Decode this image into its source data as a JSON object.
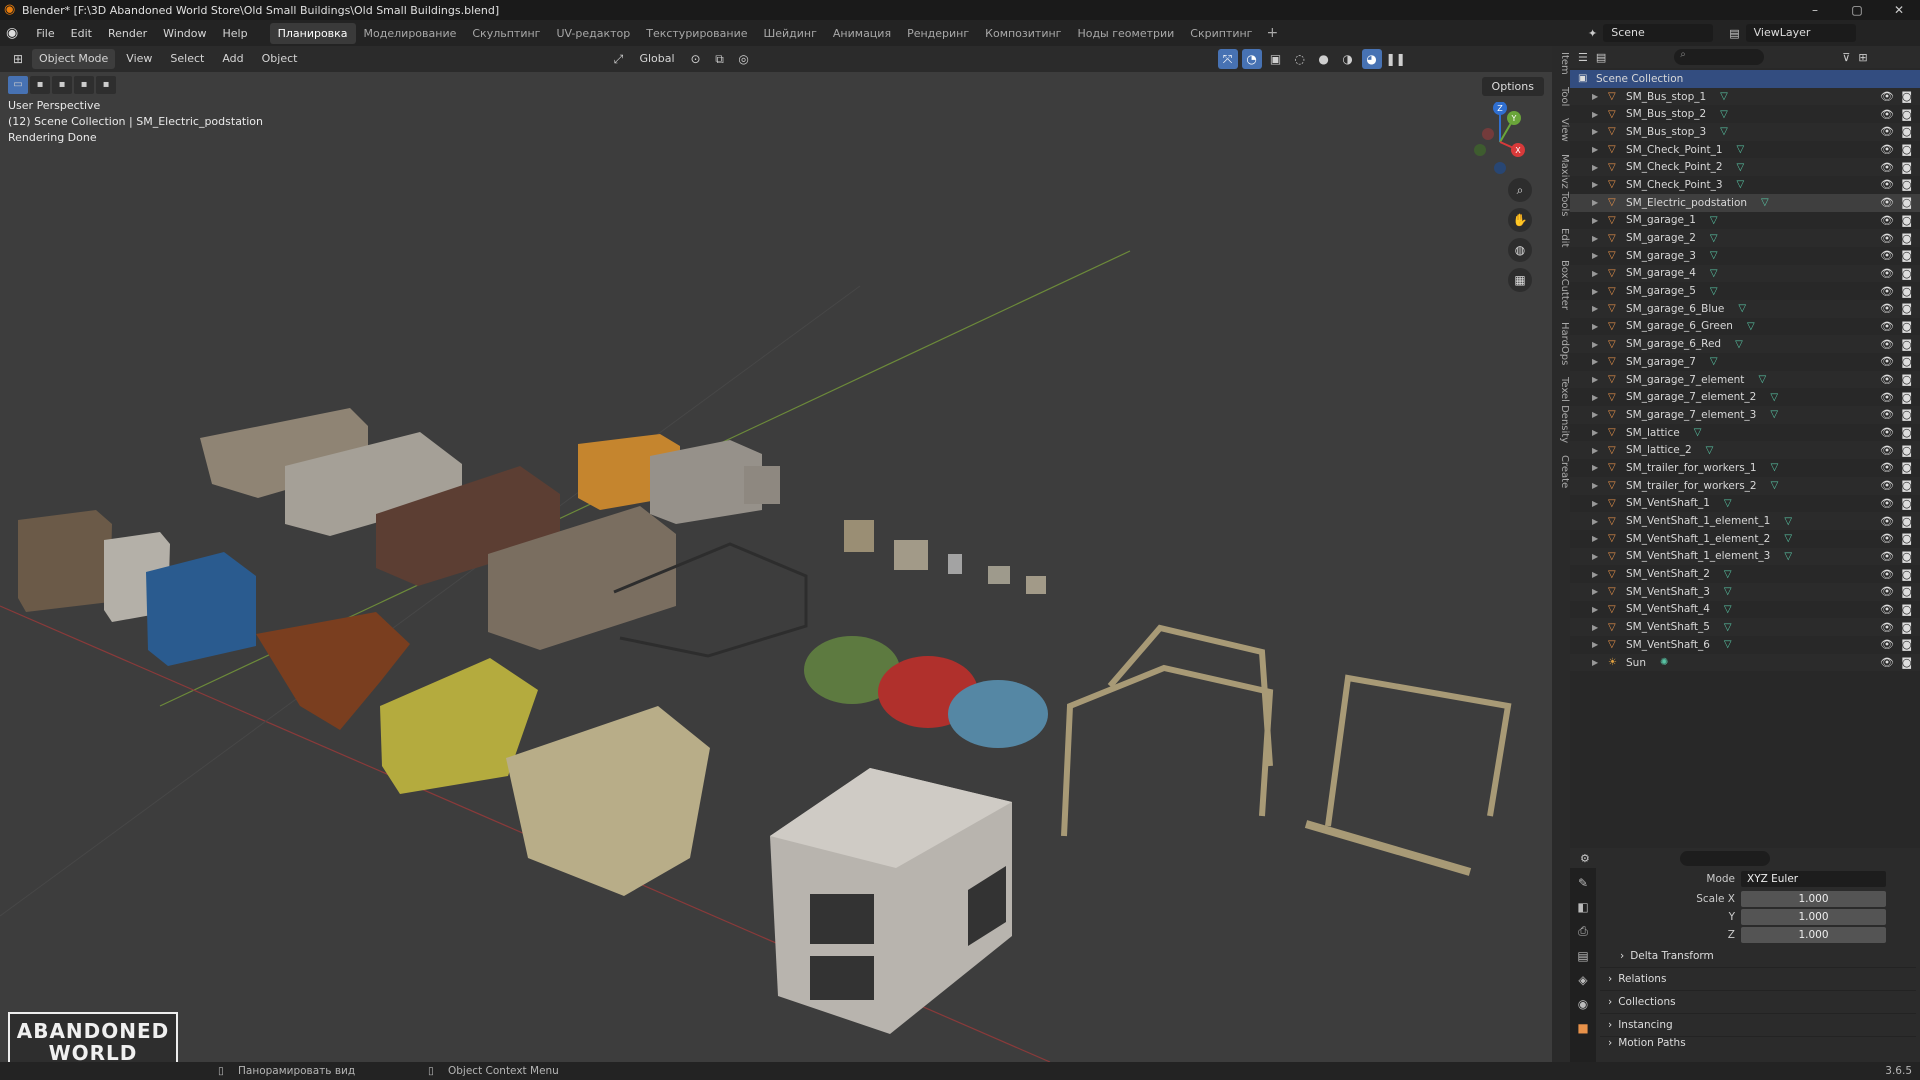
{
  "window": {
    "title": "Blender* [F:\\3D Abandoned World Store\\Old Small Buildings\\Old Small Buildings.blend]",
    "controls": [
      "–",
      "▢",
      "✕"
    ]
  },
  "menubar": {
    "items": [
      "File",
      "Edit",
      "Render",
      "Window",
      "Help"
    ],
    "workspaces": [
      "Планировка",
      "Моделирование",
      "Скульптинг",
      "UV-редактор",
      "Текстурирование",
      "Шейдинг",
      "Анимация",
      "Рендеринг",
      "Композитинг",
      "Ноды геометрии",
      "Скриптинг"
    ],
    "active_workspace": "Планировка",
    "add": "+"
  },
  "topright": {
    "scene": "Scene",
    "view_layer": "ViewLayer"
  },
  "viewport": {
    "mode": "Object Mode",
    "menus": [
      "View",
      "Select",
      "Add",
      "Object"
    ],
    "transform_orientation": "Global",
    "options_label": "Options",
    "info_lines": [
      "User Perspective",
      "(12) Scene Collection | SM_Electric_podstation",
      "Rendering Done"
    ],
    "gizmo_axes": {
      "x": "X",
      "y": "Y",
      "z": "Z"
    }
  },
  "npanel_tabs": [
    "Item",
    "Tool",
    "View",
    "Maxivz Tools",
    "Edit",
    "BoxCutter",
    "HardOps",
    "Texel Density",
    "Create"
  ],
  "outliner": {
    "root": "Scene Collection",
    "items": [
      {
        "name": "SM_Bus_stop_1",
        "kind": "mesh"
      },
      {
        "name": "SM_Bus_stop_2",
        "kind": "mesh"
      },
      {
        "name": "SM_Bus_stop_3",
        "kind": "mesh"
      },
      {
        "name": "SM_Check_Point_1",
        "kind": "mesh"
      },
      {
        "name": "SM_Check_Point_2",
        "kind": "mesh"
      },
      {
        "name": "SM_Check_Point_3",
        "kind": "mesh"
      },
      {
        "name": "SM_Electric_podstation",
        "kind": "mesh",
        "selected": true
      },
      {
        "name": "SM_garage_1",
        "kind": "mesh"
      },
      {
        "name": "SM_garage_2",
        "kind": "mesh"
      },
      {
        "name": "SM_garage_3",
        "kind": "mesh"
      },
      {
        "name": "SM_garage_4",
        "kind": "mesh"
      },
      {
        "name": "SM_garage_5",
        "kind": "mesh"
      },
      {
        "name": "SM_garage_6_Blue",
        "kind": "mesh"
      },
      {
        "name": "SM_garage_6_Green",
        "kind": "mesh"
      },
      {
        "name": "SM_garage_6_Red",
        "kind": "mesh"
      },
      {
        "name": "SM_garage_7",
        "kind": "mesh"
      },
      {
        "name": "SM_garage_7_element",
        "kind": "mesh"
      },
      {
        "name": "SM_garage_7_element_2",
        "kind": "mesh"
      },
      {
        "name": "SM_garage_7_element_3",
        "kind": "mesh"
      },
      {
        "name": "SM_lattice",
        "kind": "mesh"
      },
      {
        "name": "SM_lattice_2",
        "kind": "mesh"
      },
      {
        "name": "SM_trailer_for_workers_1",
        "kind": "mesh"
      },
      {
        "name": "SM_trailer_for_workers_2",
        "kind": "mesh"
      },
      {
        "name": "SM_VentShaft_1",
        "kind": "mesh"
      },
      {
        "name": "SM_VentShaft_1_element_1",
        "kind": "mesh"
      },
      {
        "name": "SM_VentShaft_1_element_2",
        "kind": "mesh"
      },
      {
        "name": "SM_VentShaft_1_element_3",
        "kind": "mesh"
      },
      {
        "name": "SM_VentShaft_2",
        "kind": "mesh"
      },
      {
        "name": "SM_VentShaft_3",
        "kind": "mesh"
      },
      {
        "name": "SM_VentShaft_4",
        "kind": "mesh"
      },
      {
        "name": "SM_VentShaft_5",
        "kind": "mesh"
      },
      {
        "name": "SM_VentShaft_6",
        "kind": "mesh"
      },
      {
        "name": "Sun",
        "kind": "light"
      }
    ]
  },
  "properties": {
    "mode_label": "Mode",
    "mode_value": "XYZ Euler",
    "scale": [
      {
        "label": "Scale X",
        "value": "1.000"
      },
      {
        "label": "Y",
        "value": "1.000"
      },
      {
        "label": "Z",
        "value": "1.000"
      }
    ],
    "delta_transform": "Delta Transform",
    "sections": [
      "Relations",
      "Collections",
      "Instancing",
      "Motion Paths"
    ]
  },
  "statusbar": {
    "pan": "Панорамировать вид",
    "context_menu": "Object Context Menu",
    "version": "3.6.5"
  },
  "watermark": {
    "line1": "ABANDONED",
    "line2": "WORLD"
  },
  "colors": {
    "accent": "#4772b3",
    "object_orange": "#e8924a",
    "mesh_green": "#58c4a4",
    "viewport_bg": "#3d3d3d"
  }
}
